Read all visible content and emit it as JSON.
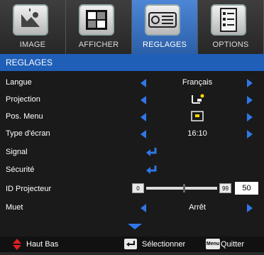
{
  "tabs": [
    {
      "label": "IMAGE",
      "icon": "picture-icon"
    },
    {
      "label": "AFFICHER",
      "icon": "display-icon"
    },
    {
      "label": "REGLAGES",
      "icon": "projector-settings-icon"
    },
    {
      "label": "OPTIONS",
      "icon": "options-list-icon"
    }
  ],
  "active_tab": "REGLAGES",
  "section_title": "REGLAGES",
  "rows": {
    "langue": {
      "label": "Langue",
      "value": "Français"
    },
    "projection": {
      "label": "Projection"
    },
    "pos_menu": {
      "label": "Pos. Menu"
    },
    "type_ecran": {
      "label": "Type d'écran",
      "value": "16:10"
    },
    "signal": {
      "label": "Signal"
    },
    "securite": {
      "label": "Sécurité"
    },
    "id_projecteur": {
      "label": "ID Projecteur",
      "min": "0",
      "max": "99",
      "value": "50"
    },
    "muet": {
      "label": "Muet",
      "value": "Arrêt"
    }
  },
  "footer": {
    "nav_text": "Haut Bas",
    "select_text": "Sélectionner",
    "menu_key": "Menu",
    "quit_text": "Quitter"
  },
  "colors": {
    "accent_blue": "#2f77e6",
    "header_blue": "#1f5fb8",
    "nav_red": "#e02020"
  }
}
